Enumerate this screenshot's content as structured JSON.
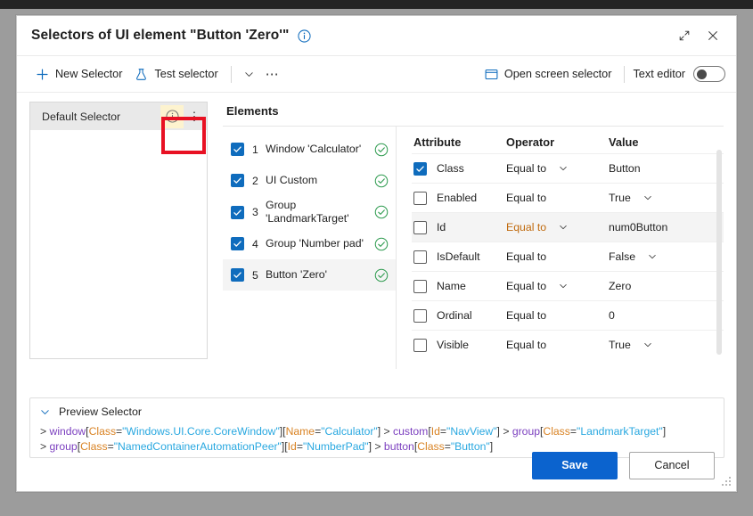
{
  "window": {
    "title": "Selectors of UI element \"Button 'Zero'\"",
    "info_icon": "info-circle-icon",
    "restore_icon": "restore-diagonal-icon",
    "close_icon": "close-x-icon"
  },
  "toolbar": {
    "new_selector": "New Selector",
    "new_selector_icon": "plus-icon",
    "test_selector": "Test selector",
    "test_selector_icon": "flask-icon",
    "chevron_icon": "chevron-down-icon",
    "overflow_icon": "ellipsis-icon",
    "open_screen_selector": "Open screen selector",
    "open_screen_selector_icon": "screen-rectangle-icon",
    "text_editor_label": "Text editor",
    "text_editor_on": false
  },
  "selector_panel": {
    "name": "Default Selector",
    "info_icon": "info-circle-icon",
    "kebab_icon": "more-vertical-icon",
    "highlight_color": "#e81123",
    "info_badge_color": "#fdf3cf"
  },
  "elements": {
    "heading": "Elements",
    "items": [
      {
        "num": "1",
        "name": "Window 'Calculator'",
        "checked": true,
        "status": "valid",
        "selected": false
      },
      {
        "num": "2",
        "name": "UI Custom",
        "checked": true,
        "status": "valid",
        "selected": false
      },
      {
        "num": "3",
        "name": "Group 'LandmarkTarget'",
        "checked": true,
        "status": "valid",
        "selected": false
      },
      {
        "num": "4",
        "name": "Group 'Number pad'",
        "checked": true,
        "status": "valid",
        "selected": false
      },
      {
        "num": "5",
        "name": "Button 'Zero'",
        "checked": true,
        "status": "valid",
        "selected": true
      }
    ]
  },
  "attributes": {
    "columns": {
      "attribute": "Attribute",
      "operator": "Operator",
      "value": "Value"
    },
    "rows": [
      {
        "attribute": "Class",
        "checked": true,
        "operator": "Equal to",
        "operator_highlight": false,
        "operator_dropdown": true,
        "value": "Button",
        "value_dropdown": false,
        "alt": false
      },
      {
        "attribute": "Enabled",
        "checked": false,
        "operator": "Equal to",
        "operator_highlight": false,
        "operator_dropdown": false,
        "value": "True",
        "value_dropdown": true,
        "alt": false
      },
      {
        "attribute": "Id",
        "checked": false,
        "operator": "Equal to",
        "operator_highlight": true,
        "operator_dropdown": true,
        "value": "num0Button",
        "value_dropdown": false,
        "alt": true
      },
      {
        "attribute": "IsDefault",
        "checked": false,
        "operator": "Equal to",
        "operator_highlight": false,
        "operator_dropdown": false,
        "value": "False",
        "value_dropdown": true,
        "alt": false
      },
      {
        "attribute": "Name",
        "checked": false,
        "operator": "Equal to",
        "operator_highlight": false,
        "operator_dropdown": true,
        "value": "Zero",
        "value_dropdown": false,
        "alt": false
      },
      {
        "attribute": "Ordinal",
        "checked": false,
        "operator": "Equal to",
        "operator_highlight": false,
        "operator_dropdown": false,
        "value": "0",
        "value_dropdown": false,
        "alt": false
      },
      {
        "attribute": "Visible",
        "checked": false,
        "operator": "Equal to",
        "operator_highlight": false,
        "operator_dropdown": false,
        "value": "True",
        "value_dropdown": true,
        "alt": false
      }
    ]
  },
  "preview": {
    "heading": "Preview Selector",
    "chevron_icon": "chevron-down-icon",
    "lines": [
      [
        {
          "t": "gt",
          "s": "> "
        },
        {
          "t": "tag",
          "s": "window"
        },
        {
          "t": "br",
          "s": "["
        },
        {
          "t": "key",
          "s": "Class"
        },
        {
          "t": "eq",
          "s": "="
        },
        {
          "t": "val",
          "s": "\"Windows.UI.Core.CoreWindow\""
        },
        {
          "t": "br",
          "s": "]["
        },
        {
          "t": "key",
          "s": "Name"
        },
        {
          "t": "eq",
          "s": "="
        },
        {
          "t": "val",
          "s": "\"Calculator\""
        },
        {
          "t": "br",
          "s": "]"
        },
        {
          "t": "gt",
          "s": " > "
        },
        {
          "t": "tag",
          "s": "custom"
        },
        {
          "t": "br",
          "s": "["
        },
        {
          "t": "key",
          "s": "Id"
        },
        {
          "t": "eq",
          "s": "="
        },
        {
          "t": "val",
          "s": "\"NavView\""
        },
        {
          "t": "br",
          "s": "]"
        },
        {
          "t": "gt",
          "s": " > "
        },
        {
          "t": "tag",
          "s": "group"
        },
        {
          "t": "br",
          "s": "["
        },
        {
          "t": "key",
          "s": "Class"
        },
        {
          "t": "eq",
          "s": "="
        },
        {
          "t": "val",
          "s": "\"LandmarkTarget\""
        },
        {
          "t": "br",
          "s": "]"
        }
      ],
      [
        {
          "t": "gt",
          "s": "> "
        },
        {
          "t": "tag",
          "s": "group"
        },
        {
          "t": "br",
          "s": "["
        },
        {
          "t": "key",
          "s": "Class"
        },
        {
          "t": "eq",
          "s": "="
        },
        {
          "t": "val",
          "s": "\"NamedContainerAutomationPeer\""
        },
        {
          "t": "br",
          "s": "]["
        },
        {
          "t": "key",
          "s": "Id"
        },
        {
          "t": "eq",
          "s": "="
        },
        {
          "t": "val",
          "s": "\"NumberPad\""
        },
        {
          "t": "br",
          "s": "]"
        },
        {
          "t": "gt",
          "s": " > "
        },
        {
          "t": "tag",
          "s": "button"
        },
        {
          "t": "br",
          "s": "["
        },
        {
          "t": "key",
          "s": "Class"
        },
        {
          "t": "eq",
          "s": "="
        },
        {
          "t": "val",
          "s": "\"Button\""
        },
        {
          "t": "br",
          "s": "]"
        }
      ]
    ]
  },
  "footer": {
    "save": "Save",
    "cancel": "Cancel",
    "save_color": "#0b63ce"
  }
}
